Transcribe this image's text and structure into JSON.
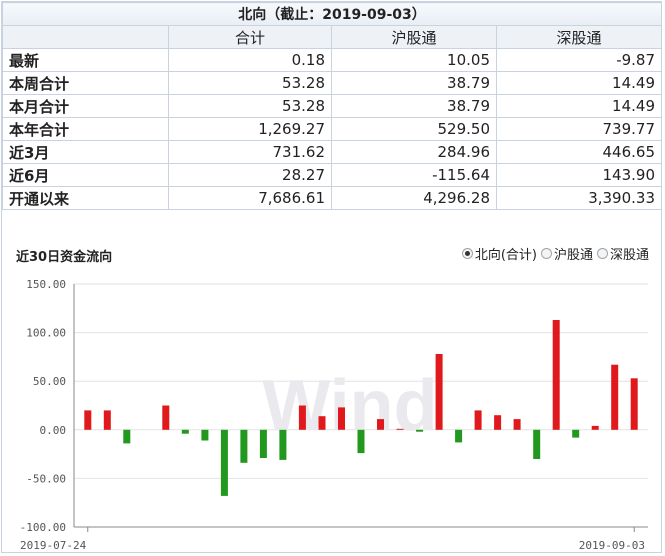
{
  "table": {
    "title": "北向（截止：2019-09-03）",
    "headers": [
      "",
      "合计",
      "沪股通",
      "深股通"
    ],
    "rows": [
      {
        "label": "最新",
        "total": "0.18",
        "sh": "10.05",
        "sz": "-9.87"
      },
      {
        "label": "本周合计",
        "total": "53.28",
        "sh": "38.79",
        "sz": "14.49"
      },
      {
        "label": "本月合计",
        "total": "53.28",
        "sh": "38.79",
        "sz": "14.49"
      },
      {
        "label": "本年合计",
        "total": "1,269.27",
        "sh": "529.50",
        "sz": "739.77"
      },
      {
        "label": "近3月",
        "total": "731.62",
        "sh": "284.96",
        "sz": "446.65"
      },
      {
        "label": "近6月",
        "total": "28.27",
        "sh": "-115.64",
        "sz": "143.90"
      },
      {
        "label": "开通以来",
        "total": "7,686.61",
        "sh": "4,296.28",
        "sz": "3,390.33"
      }
    ]
  },
  "legend": {
    "items": [
      {
        "label": "北向(合计)",
        "selected": true
      },
      {
        "label": "沪股通",
        "selected": false
      },
      {
        "label": "深股通",
        "selected": false
      }
    ]
  },
  "chart_data": {
    "type": "bar",
    "title": "近30日资金流向",
    "watermark": "Wind",
    "ylim": [
      -100,
      150
    ],
    "yticks": [
      "150.00",
      "100.00",
      "50.00",
      "0.00",
      "-50.00",
      "-100.00"
    ],
    "ytick_values": [
      150,
      100,
      50,
      0,
      -50,
      -100
    ],
    "x_start_label": "2019-07-24",
    "x_end_label": "2019-09-03",
    "values": [
      20,
      20,
      -14,
      0,
      25,
      -4,
      -11,
      -68,
      -34,
      -29,
      -31,
      25,
      14,
      23,
      -24,
      11,
      1,
      -2,
      78,
      -13,
      20,
      15,
      11,
      -30,
      113,
      -8,
      4,
      67,
      53
    ],
    "positive_color": "#e0191c",
    "negative_color": "#22981e",
    "grid": true,
    "legend_position": "top-right"
  }
}
